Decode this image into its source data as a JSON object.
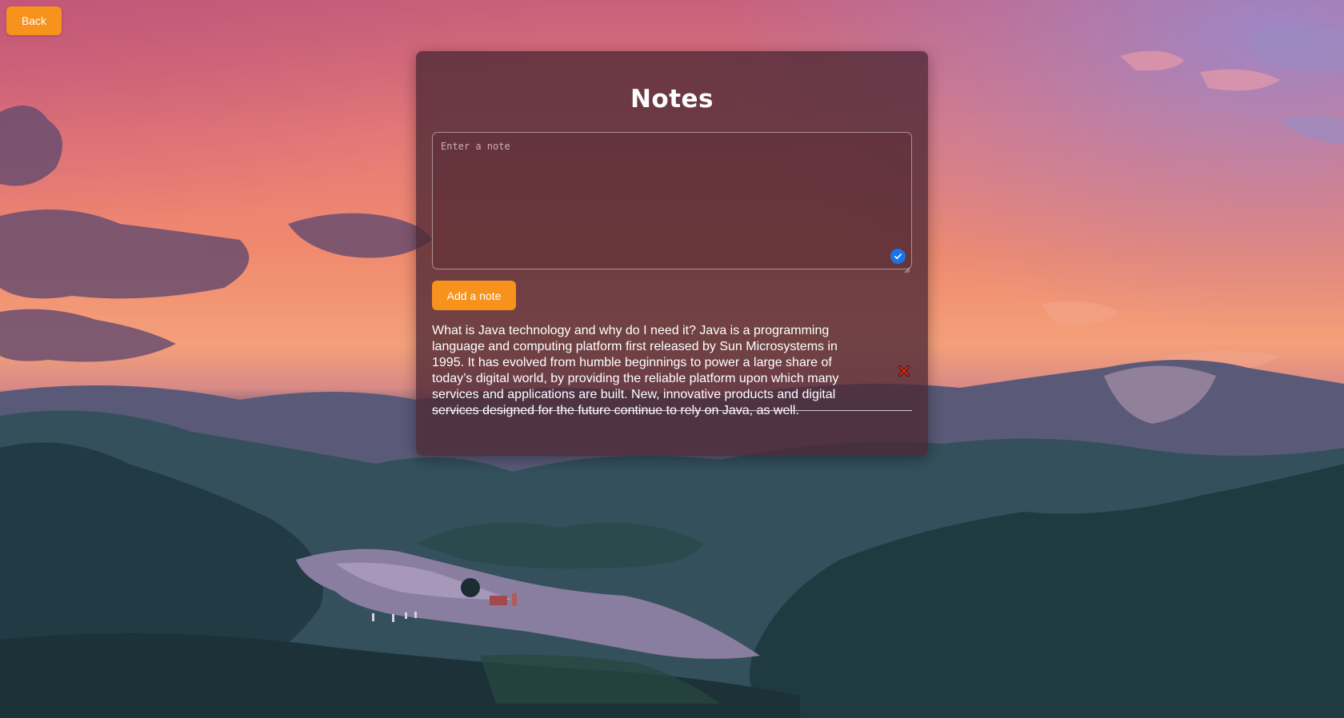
{
  "header": {
    "back_label": "Back"
  },
  "panel": {
    "title": "Notes",
    "note_input": {
      "placeholder": "Enter a note",
      "value": ""
    },
    "add_button_label": "Add a note",
    "notes": [
      {
        "text": "What is Java technology and why do I need it? Java is a programming language and computing platform first released by Sun Microsystems in 1995. It has evolved from humble beginnings to power a large share of today’s digital world, by providing the reliable platform upon which many services and applications are built. New, innovative products and digital services designed for the future continue to rely on Java, as well."
      }
    ]
  },
  "icons": {
    "input_status": "check-circle-icon",
    "delete_note": "close-x-icon"
  },
  "colors": {
    "accent_orange": "#f7921c",
    "check_blue": "#1a73e8",
    "delete_red": "#e0271a"
  }
}
